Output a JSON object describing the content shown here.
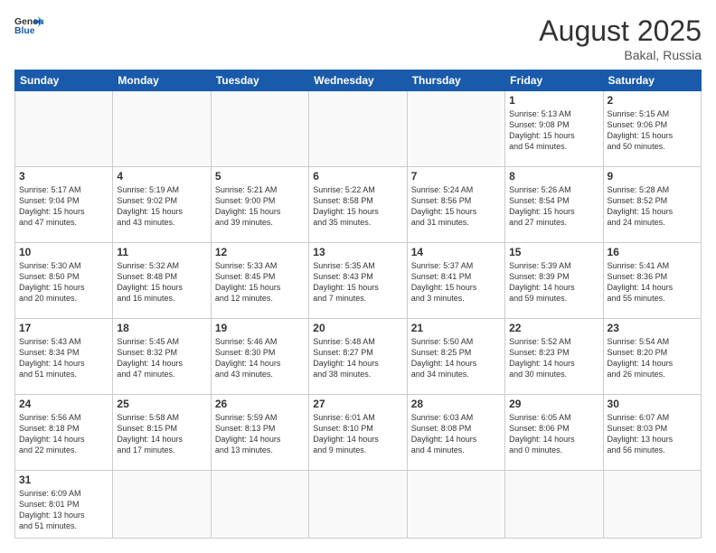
{
  "header": {
    "logo_general": "General",
    "logo_blue": "Blue",
    "month_year": "August 2025",
    "location": "Bakal, Russia"
  },
  "weekdays": [
    "Sunday",
    "Monday",
    "Tuesday",
    "Wednesday",
    "Thursday",
    "Friday",
    "Saturday"
  ],
  "weeks": [
    [
      {
        "day": "",
        "content": ""
      },
      {
        "day": "",
        "content": ""
      },
      {
        "day": "",
        "content": ""
      },
      {
        "day": "",
        "content": ""
      },
      {
        "day": "",
        "content": ""
      },
      {
        "day": "1",
        "content": "Sunrise: 5:13 AM\nSunset: 9:08 PM\nDaylight: 15 hours\nand 54 minutes."
      },
      {
        "day": "2",
        "content": "Sunrise: 5:15 AM\nSunset: 9:06 PM\nDaylight: 15 hours\nand 50 minutes."
      }
    ],
    [
      {
        "day": "3",
        "content": "Sunrise: 5:17 AM\nSunset: 9:04 PM\nDaylight: 15 hours\nand 47 minutes."
      },
      {
        "day": "4",
        "content": "Sunrise: 5:19 AM\nSunset: 9:02 PM\nDaylight: 15 hours\nand 43 minutes."
      },
      {
        "day": "5",
        "content": "Sunrise: 5:21 AM\nSunset: 9:00 PM\nDaylight: 15 hours\nand 39 minutes."
      },
      {
        "day": "6",
        "content": "Sunrise: 5:22 AM\nSunset: 8:58 PM\nDaylight: 15 hours\nand 35 minutes."
      },
      {
        "day": "7",
        "content": "Sunrise: 5:24 AM\nSunset: 8:56 PM\nDaylight: 15 hours\nand 31 minutes."
      },
      {
        "day": "8",
        "content": "Sunrise: 5:26 AM\nSunset: 8:54 PM\nDaylight: 15 hours\nand 27 minutes."
      },
      {
        "day": "9",
        "content": "Sunrise: 5:28 AM\nSunset: 8:52 PM\nDaylight: 15 hours\nand 24 minutes."
      }
    ],
    [
      {
        "day": "10",
        "content": "Sunrise: 5:30 AM\nSunset: 8:50 PM\nDaylight: 15 hours\nand 20 minutes."
      },
      {
        "day": "11",
        "content": "Sunrise: 5:32 AM\nSunset: 8:48 PM\nDaylight: 15 hours\nand 16 minutes."
      },
      {
        "day": "12",
        "content": "Sunrise: 5:33 AM\nSunset: 8:45 PM\nDaylight: 15 hours\nand 12 minutes."
      },
      {
        "day": "13",
        "content": "Sunrise: 5:35 AM\nSunset: 8:43 PM\nDaylight: 15 hours\nand 7 minutes."
      },
      {
        "day": "14",
        "content": "Sunrise: 5:37 AM\nSunset: 8:41 PM\nDaylight: 15 hours\nand 3 minutes."
      },
      {
        "day": "15",
        "content": "Sunrise: 5:39 AM\nSunset: 8:39 PM\nDaylight: 14 hours\nand 59 minutes."
      },
      {
        "day": "16",
        "content": "Sunrise: 5:41 AM\nSunset: 8:36 PM\nDaylight: 14 hours\nand 55 minutes."
      }
    ],
    [
      {
        "day": "17",
        "content": "Sunrise: 5:43 AM\nSunset: 8:34 PM\nDaylight: 14 hours\nand 51 minutes."
      },
      {
        "day": "18",
        "content": "Sunrise: 5:45 AM\nSunset: 8:32 PM\nDaylight: 14 hours\nand 47 minutes."
      },
      {
        "day": "19",
        "content": "Sunrise: 5:46 AM\nSunset: 8:30 PM\nDaylight: 14 hours\nand 43 minutes."
      },
      {
        "day": "20",
        "content": "Sunrise: 5:48 AM\nSunset: 8:27 PM\nDaylight: 14 hours\nand 38 minutes."
      },
      {
        "day": "21",
        "content": "Sunrise: 5:50 AM\nSunset: 8:25 PM\nDaylight: 14 hours\nand 34 minutes."
      },
      {
        "day": "22",
        "content": "Sunrise: 5:52 AM\nSunset: 8:23 PM\nDaylight: 14 hours\nand 30 minutes."
      },
      {
        "day": "23",
        "content": "Sunrise: 5:54 AM\nSunset: 8:20 PM\nDaylight: 14 hours\nand 26 minutes."
      }
    ],
    [
      {
        "day": "24",
        "content": "Sunrise: 5:56 AM\nSunset: 8:18 PM\nDaylight: 14 hours\nand 22 minutes."
      },
      {
        "day": "25",
        "content": "Sunrise: 5:58 AM\nSunset: 8:15 PM\nDaylight: 14 hours\nand 17 minutes."
      },
      {
        "day": "26",
        "content": "Sunrise: 5:59 AM\nSunset: 8:13 PM\nDaylight: 14 hours\nand 13 minutes."
      },
      {
        "day": "27",
        "content": "Sunrise: 6:01 AM\nSunset: 8:10 PM\nDaylight: 14 hours\nand 9 minutes."
      },
      {
        "day": "28",
        "content": "Sunrise: 6:03 AM\nSunset: 8:08 PM\nDaylight: 14 hours\nand 4 minutes."
      },
      {
        "day": "29",
        "content": "Sunrise: 6:05 AM\nSunset: 8:06 PM\nDaylight: 14 hours\nand 0 minutes."
      },
      {
        "day": "30",
        "content": "Sunrise: 6:07 AM\nSunset: 8:03 PM\nDaylight: 13 hours\nand 56 minutes."
      }
    ],
    [
      {
        "day": "31",
        "content": "Sunrise: 6:09 AM\nSunset: 8:01 PM\nDaylight: 13 hours\nand 51 minutes."
      },
      {
        "day": "",
        "content": ""
      },
      {
        "day": "",
        "content": ""
      },
      {
        "day": "",
        "content": ""
      },
      {
        "day": "",
        "content": ""
      },
      {
        "day": "",
        "content": ""
      },
      {
        "day": "",
        "content": ""
      }
    ]
  ]
}
